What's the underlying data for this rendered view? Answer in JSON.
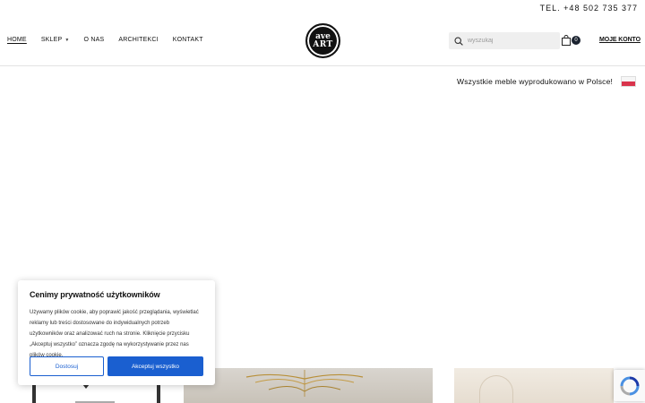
{
  "topbar": {
    "phone": "TEL. +48 502 735 377"
  },
  "nav": {
    "items": [
      {
        "label": "HOME",
        "active": true
      },
      {
        "label": "SKLEP",
        "has_dropdown": true
      },
      {
        "label": "O NAS"
      },
      {
        "label": "ARCHITEKCI"
      },
      {
        "label": "KONTAKT"
      }
    ]
  },
  "logo": {
    "line1": "ave",
    "line2": "ART"
  },
  "search": {
    "placeholder": "wyszukaj",
    "value": ""
  },
  "cart": {
    "count": "0"
  },
  "account": {
    "label": "MOJE KONTO"
  },
  "banner": {
    "text": "Wszystkie meble wyprodukowano w Polsce!"
  },
  "cookie": {
    "title": "Cenimy prywatność użytkowników",
    "body": "Używamy plików cookie, aby poprawić jakość przeglądania, wyświetlać reklamy lub treści dostosowane do indywidualnych potrzeb użytkowników oraz analizować ruch na stronie. Kliknięcie przycisku „Akceptuj wszystko” oznacza zgodę na wykorzystywanie przez nas plików cookie.",
    "customize_label": "Dostosuj",
    "accept_label": "Akceptuj wszystko"
  },
  "colors": {
    "accent": "#1a5fd0",
    "badge": "#1b2330",
    "flag_red": "#d9344c"
  }
}
